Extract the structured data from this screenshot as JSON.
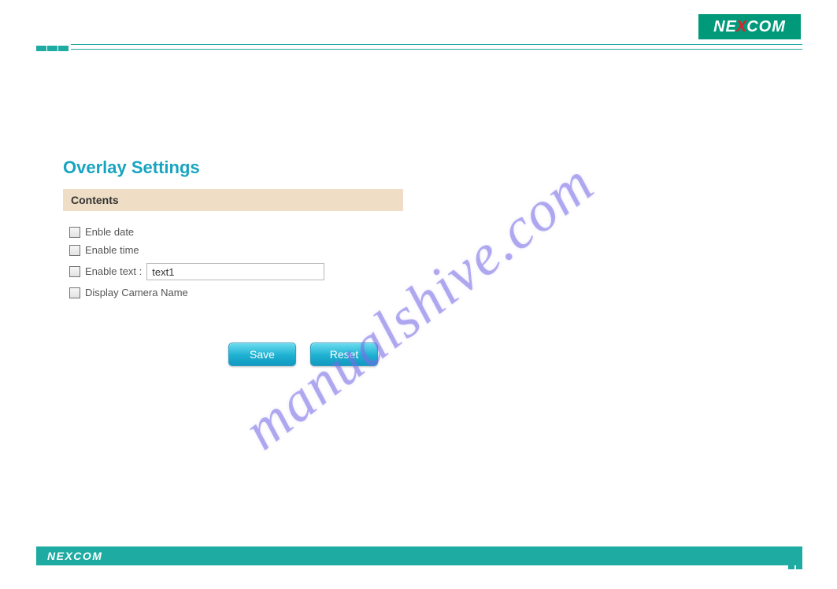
{
  "brand": {
    "name": "NEXCOM"
  },
  "page_title": "Overlay Settings",
  "section": {
    "title": "Contents"
  },
  "fields": {
    "enable_date": {
      "label": "Enble date",
      "checked": false
    },
    "enable_time": {
      "label": "Enable time",
      "checked": false
    },
    "enable_text": {
      "label": "Enable text :",
      "checked": false,
      "value": "text1"
    },
    "display_camera_name": {
      "label": "Display Camera Name",
      "checked": false
    }
  },
  "buttons": {
    "save": "Save",
    "reset": "Reset"
  },
  "watermark": "manualshive.com"
}
